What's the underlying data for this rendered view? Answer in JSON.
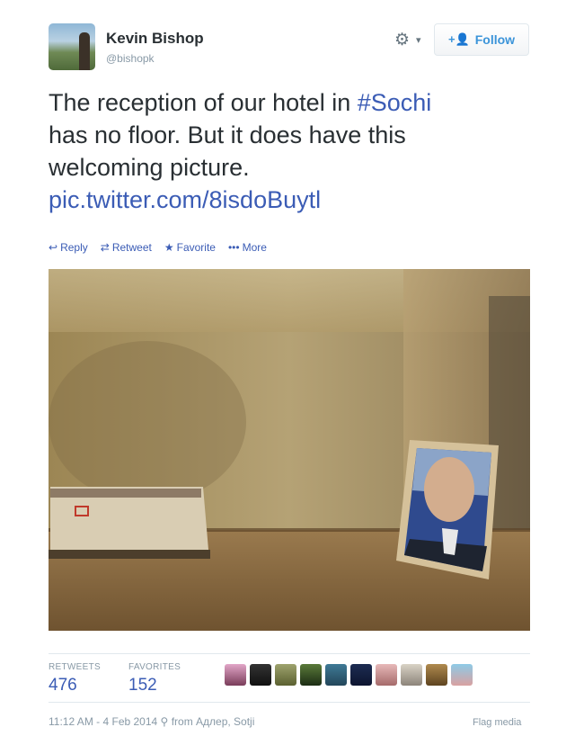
{
  "user": {
    "name": "Kevin Bishop",
    "handle": "@bishopk"
  },
  "follow_label": "Follow",
  "tweet": {
    "line1_prefix": "The reception of our hotel in ",
    "hashtag": "#Sochi",
    "line2": "has no floor. But it does have this",
    "line3": "welcoming picture.",
    "link": "pic.twitter.com/8isdoBuytl"
  },
  "actions": {
    "reply": "Reply",
    "retweet": "Retweet",
    "favorite": "Favorite",
    "more": "More"
  },
  "stats": {
    "retweets_label": "RETWEETS",
    "retweets": "476",
    "favorites_label": "FAVORITES",
    "favorites": "152"
  },
  "footer": {
    "timestamp": "11:12 AM - 4 Feb 2014",
    "location": "from Адлер, Sotji",
    "flag": "Flag media"
  },
  "icons": [
    "gear-icon",
    "chevron-down-icon",
    "follow-plus-icon",
    "reply-icon",
    "retweet-icon",
    "star-icon",
    "more-icon",
    "location-pin-icon"
  ]
}
